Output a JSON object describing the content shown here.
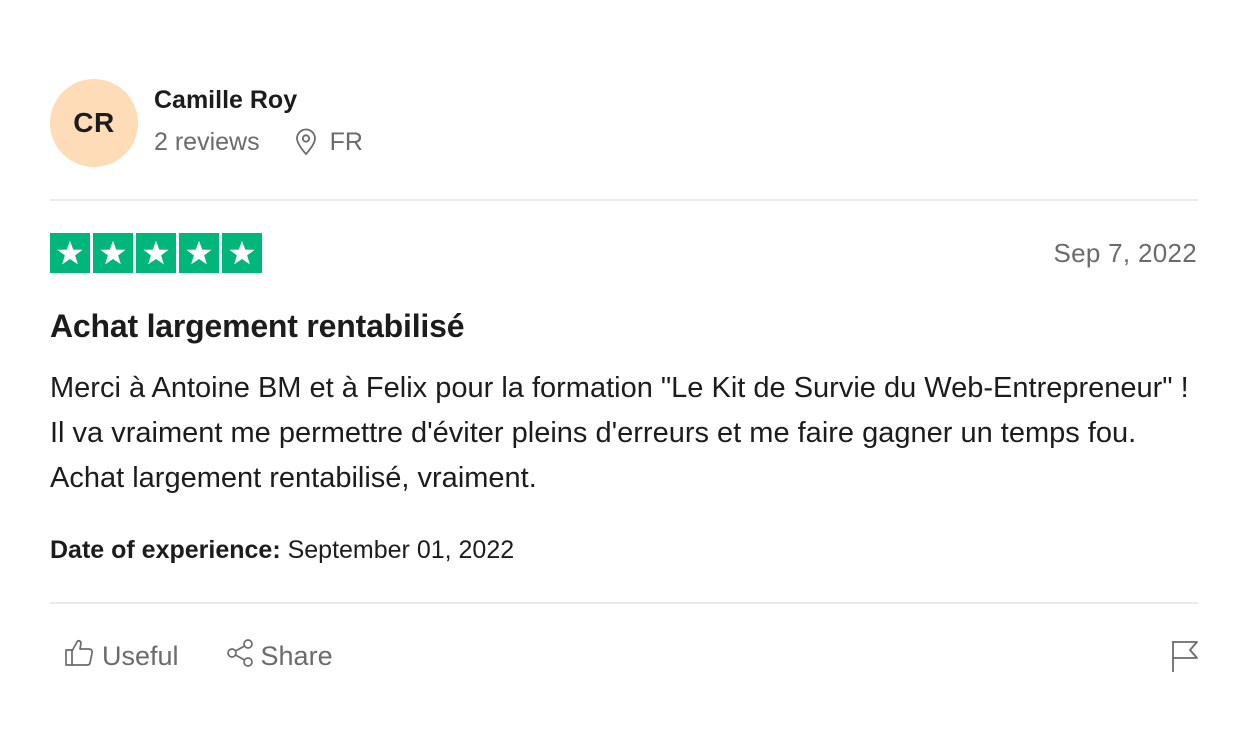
{
  "reviewer": {
    "initials": "CR",
    "name": "Camille Roy",
    "reviews_count": "2 reviews",
    "location": "FR",
    "avatar_color": "#ffdcb8"
  },
  "review": {
    "rating": 5,
    "rating_max": 5,
    "star_color": "#00b67a",
    "date": "Sep 7, 2022",
    "title": "Achat largement rentabilisé",
    "body": "Merci à Antoine BM et à Felix pour la formation \"Le Kit de Survie du Web-Entrepreneur\" ! Il va vraiment me permettre d'éviter pleins d'erreurs et me faire gagner un temps fou. Achat largement rentabilisé, vraiment.",
    "experience_label": "Date of experience:",
    "experience_date": "September 01, 2022"
  },
  "actions": {
    "useful_label": "Useful",
    "share_label": "Share",
    "icons": [
      "thumbs-up-icon",
      "share-icon",
      "flag-icon",
      "location-pin-icon",
      "star-icon"
    ]
  }
}
